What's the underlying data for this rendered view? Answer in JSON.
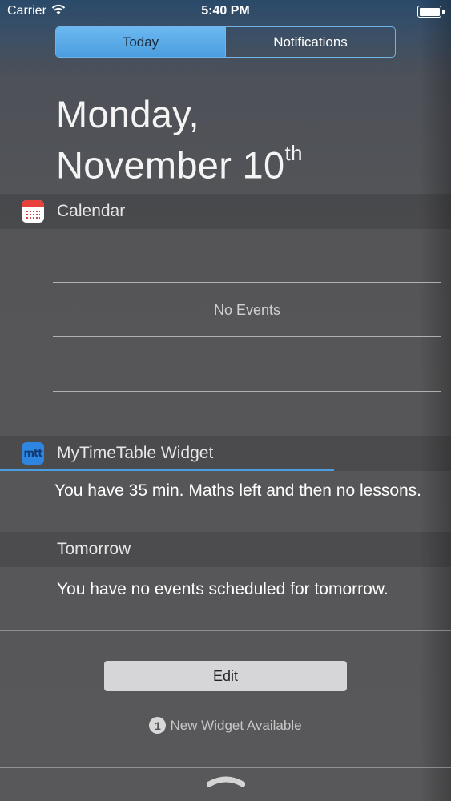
{
  "status_bar": {
    "carrier": "Carrier",
    "time": "5:40 PM",
    "icons": [
      "wifi-icon",
      "battery-icon"
    ]
  },
  "tabs": [
    {
      "label": "Today",
      "active": true
    },
    {
      "label": "Notifications",
      "active": false
    }
  ],
  "date": {
    "line1": "Monday,",
    "line2": "November 10",
    "suffix": "th"
  },
  "calendar": {
    "title": "Calendar",
    "icon": "calendar-app-icon",
    "empty_text": "No Events"
  },
  "mytimetable": {
    "title": "MyTimeTable Widget",
    "icon": "mytimetable-app-icon",
    "icon_text": "mtt",
    "message": "You have 35 min. Maths left and then no lessons.",
    "tomorrow_header": "Tomorrow",
    "tomorrow_message": "You have no events scheduled for tomorrow."
  },
  "footer": {
    "edit_label": "Edit",
    "new_widget_count": "1",
    "new_widget_text": "New Widget Available",
    "handle_icon": "grabber-handle-icon"
  },
  "colors": {
    "accent": "#4a9fe4",
    "calendar_red": "#e8403a",
    "mtt_blue": "#2f86e0"
  }
}
